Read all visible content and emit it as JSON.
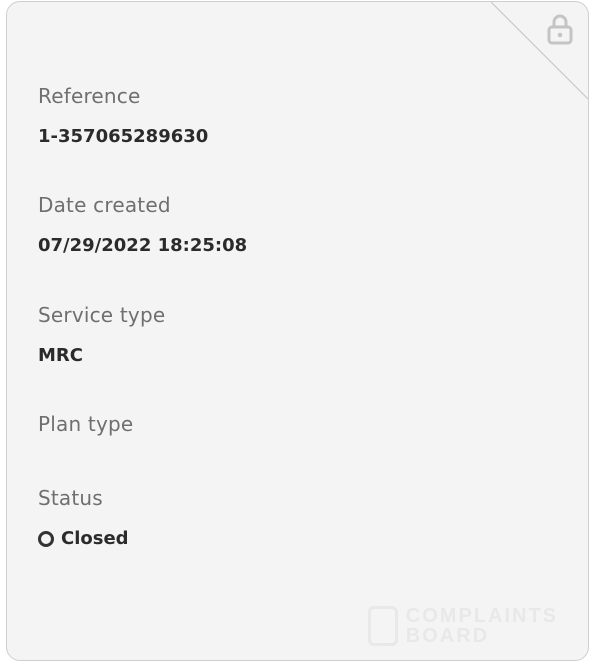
{
  "fields": {
    "reference": {
      "label": "Reference",
      "value": "1-357065289630"
    },
    "date_created": {
      "label": "Date created",
      "value": "07/29/2022 18:25:08"
    },
    "service_type": {
      "label": "Service type",
      "value": "MRC"
    },
    "plan_type": {
      "label": "Plan type",
      "value": ""
    },
    "status": {
      "label": "Status",
      "value": "Closed"
    }
  },
  "icons": {
    "lock": "lock-icon",
    "status": "status-ring-icon"
  },
  "watermark": {
    "line1": "COMPLAINTS",
    "line2": "BOARD"
  },
  "colors": {
    "card_background": "#f4f4f4",
    "label_text": "#6f6f6f",
    "value_text": "#2b2b2b"
  }
}
